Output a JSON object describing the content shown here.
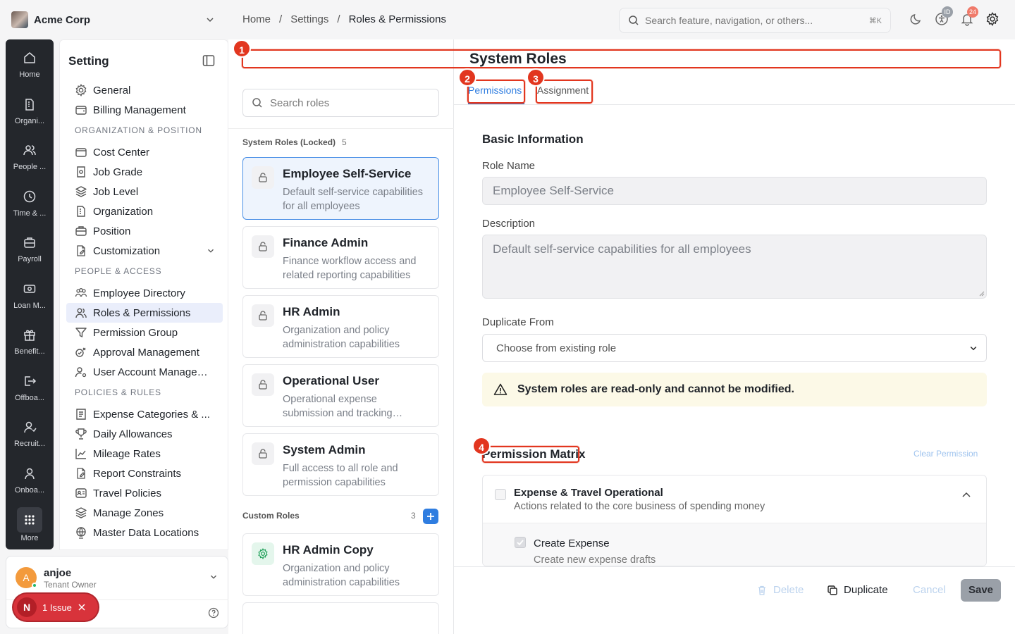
{
  "org": {
    "name": "Acme Corp"
  },
  "breadcrumb": [
    "Home",
    "Settings",
    "Roles & Permissions"
  ],
  "search": {
    "placeholder": "Search feature, navigation, or others...",
    "shortcut": "⌘K"
  },
  "header_badges": {
    "id": "ID",
    "notifications": "24"
  },
  "rail": {
    "items": [
      {
        "label": "Home",
        "icon": "home-icon"
      },
      {
        "label": "Organi...",
        "icon": "building-icon"
      },
      {
        "label": "People ...",
        "icon": "people-icon"
      },
      {
        "label": "Time & ...",
        "icon": "clock-icon"
      },
      {
        "label": "Payroll",
        "icon": "briefcase-icon"
      },
      {
        "label": "Loan M...",
        "icon": "money-icon"
      },
      {
        "label": "Benefit...",
        "icon": "gift-icon"
      },
      {
        "label": "Offboa...",
        "icon": "logout-icon"
      },
      {
        "label": "Recruit...",
        "icon": "user-plus-icon"
      },
      {
        "label": "Onboa...",
        "icon": "user-icon"
      }
    ],
    "more": "More"
  },
  "settings": {
    "title": "Setting",
    "items": [
      {
        "label": "General",
        "icon": "gear-icon"
      },
      {
        "label": "Billing Management",
        "icon": "wallet-icon"
      },
      {
        "section": "ORGANIZATION & POSITION"
      },
      {
        "label": "Cost Center",
        "icon": "wallet-icon"
      },
      {
        "label": "Job Grade",
        "icon": "badge-icon"
      },
      {
        "label": "Job Level",
        "icon": "layers-icon"
      },
      {
        "label": "Organization",
        "icon": "building-icon"
      },
      {
        "label": "Position",
        "icon": "briefcase-icon"
      },
      {
        "label": "Customization",
        "icon": "file-edit-icon"
      },
      {
        "section": "PEOPLE & ACCESS"
      },
      {
        "label": "Employee Directory",
        "icon": "people-icon"
      },
      {
        "label": "Roles & Permissions",
        "icon": "people-icon"
      },
      {
        "label": "Permission Group",
        "icon": "filter-icon"
      },
      {
        "label": "Approval Management",
        "icon": "approval-icon"
      },
      {
        "label": "User Account Managem...",
        "icon": "user-gear-icon"
      },
      {
        "section": "POLICIES & RULES"
      },
      {
        "label": "Expense Categories & ...",
        "icon": "receipt-icon"
      },
      {
        "label": "Daily Allowances",
        "icon": "trophy-icon"
      },
      {
        "label": "Mileage Rates",
        "icon": "chart-icon"
      },
      {
        "label": "Report Constraints",
        "icon": "file-edit-icon"
      },
      {
        "label": "Travel Policies",
        "icon": "id-card-icon"
      },
      {
        "label": "Manage Zones",
        "icon": "layers-icon"
      },
      {
        "label": "Master Data Locations",
        "icon": "globe-icon"
      }
    ]
  },
  "user": {
    "initial": "A",
    "name": "anjoe",
    "role": "Tenant Owner"
  },
  "issue": {
    "initial": "N",
    "label": "1 Issue"
  },
  "roles": {
    "search_placeholder": "Search roles",
    "system_header": "System Roles (Locked)",
    "system_count": "5",
    "custom_header": "Custom Roles",
    "custom_count": "3",
    "system": [
      {
        "name": "Employee Self-Service",
        "desc": "Default self-service capabilities for all employees"
      },
      {
        "name": "Finance Admin",
        "desc": "Finance workflow access and related reporting capabilities"
      },
      {
        "name": "HR Admin",
        "desc": "Organization and policy administration capabilities"
      },
      {
        "name": "Operational User",
        "desc": "Operational expense submission and tracking capabilities"
      },
      {
        "name": "System Admin",
        "desc": "Full access to all role and permission capabilities"
      }
    ],
    "custom": [
      {
        "name": "HR Admin Copy",
        "desc": "Organization and policy administration capabilities"
      }
    ]
  },
  "main": {
    "title": "System Roles",
    "tabs": [
      "Permissions",
      "Assignment"
    ],
    "basic_info": "Basic Information",
    "role_name_label": "Role Name",
    "role_name_value": "Employee Self-Service",
    "description_label": "Description",
    "description_value": "Default self-service capabilities for all employees",
    "duplicate_label": "Duplicate From",
    "duplicate_placeholder": "Choose from existing role",
    "warning": "System roles are read-only and cannot be modified.",
    "matrix_title": "Permission Matrix",
    "clear_permission": "Clear Permission",
    "group": {
      "title": "Expense & Travel Operational",
      "desc": "Actions related to the core business of spending money"
    },
    "perm": {
      "title": "Create Expense",
      "desc": "Create new expense drafts"
    },
    "footer": {
      "delete": "Delete",
      "duplicate": "Duplicate",
      "cancel": "Cancel",
      "save": "Save"
    }
  },
  "annotations": [
    "1",
    "2",
    "3",
    "4"
  ],
  "colors": {
    "accent": "#2f7de0",
    "annotation": "#e2361f",
    "rail": "#24272c",
    "warning_bg": "#fcf9e7"
  }
}
